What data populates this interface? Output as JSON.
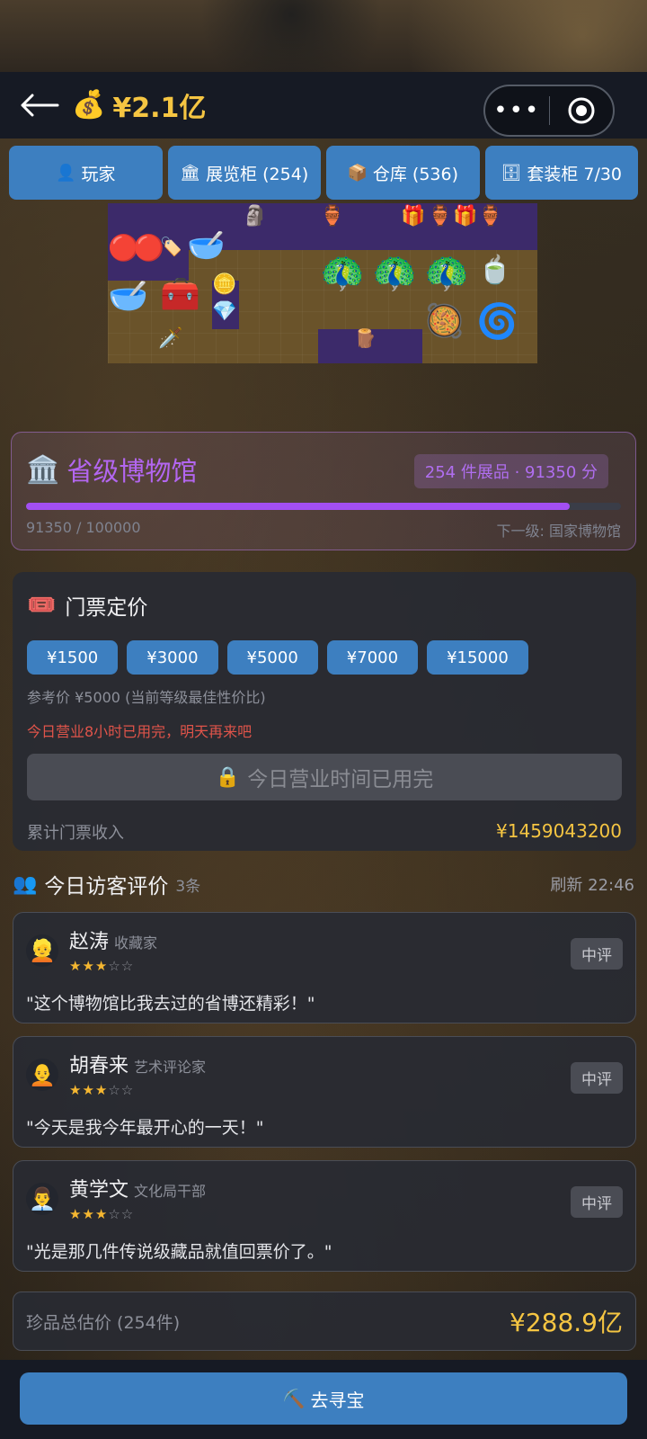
{
  "header": {
    "money_icon": "money-bag-icon",
    "money": "¥2.1亿"
  },
  "tabs": [
    {
      "icon": "👤",
      "label": "玩家"
    },
    {
      "icon": "🏛",
      "label": "展览柜 (254)"
    },
    {
      "icon": "📦",
      "label": "仓库 (536)"
    },
    {
      "icon": "🗄",
      "label": "套装柜 7/30"
    }
  ],
  "museum": {
    "icon": "🏛️",
    "title": "省级博物馆",
    "badge": "254 件展品 · 91350 分",
    "progress_text": "91350 / 100000",
    "progress_fraction": 0.9135,
    "next_level": "下一级: 国家博物馆",
    "accent_color": "#a24ff2"
  },
  "ticket": {
    "icon": "🎟️",
    "title": "门票定价",
    "prices": [
      "¥1500",
      "¥3000",
      "¥5000",
      "¥7000",
      "¥15000"
    ],
    "reference": "参考价 ¥5000 (当前等级最佳性价比)",
    "warning": "今日营业8小时已用完，明天再来吧",
    "closed_button": "今日营业时间已用完",
    "income_label": "累计门票收入",
    "income_value": "¥1459043200"
  },
  "reviews": {
    "title": "今日访客评价",
    "count": "3条",
    "refresh": "刷新 22:46",
    "items": [
      {
        "avatar": "👱",
        "name": "赵涛",
        "role": "收藏家",
        "stars": "★★★",
        "stars_off": "☆☆",
        "tag": "中评",
        "quote": "\"这个博物馆比我去过的省博还精彩！\""
      },
      {
        "avatar": "🧑‍🦲",
        "name": "胡春来",
        "role": "艺术评论家",
        "stars": "★★★",
        "stars_off": "☆☆",
        "tag": "中评",
        "quote": "\"今天是我今年最开心的一天！\""
      },
      {
        "avatar": "👨‍💼",
        "name": "黄学文",
        "role": "文化局干部",
        "stars": "★★★",
        "stars_off": "☆☆",
        "tag": "中评",
        "quote": "\"光是那几件传说级藏品就值回票价了。\""
      }
    ]
  },
  "total": {
    "label": "珍品总估价 (254件)",
    "value": "¥288.9亿"
  },
  "bottom": {
    "icon": "⛏️",
    "label": "去寻宝"
  }
}
